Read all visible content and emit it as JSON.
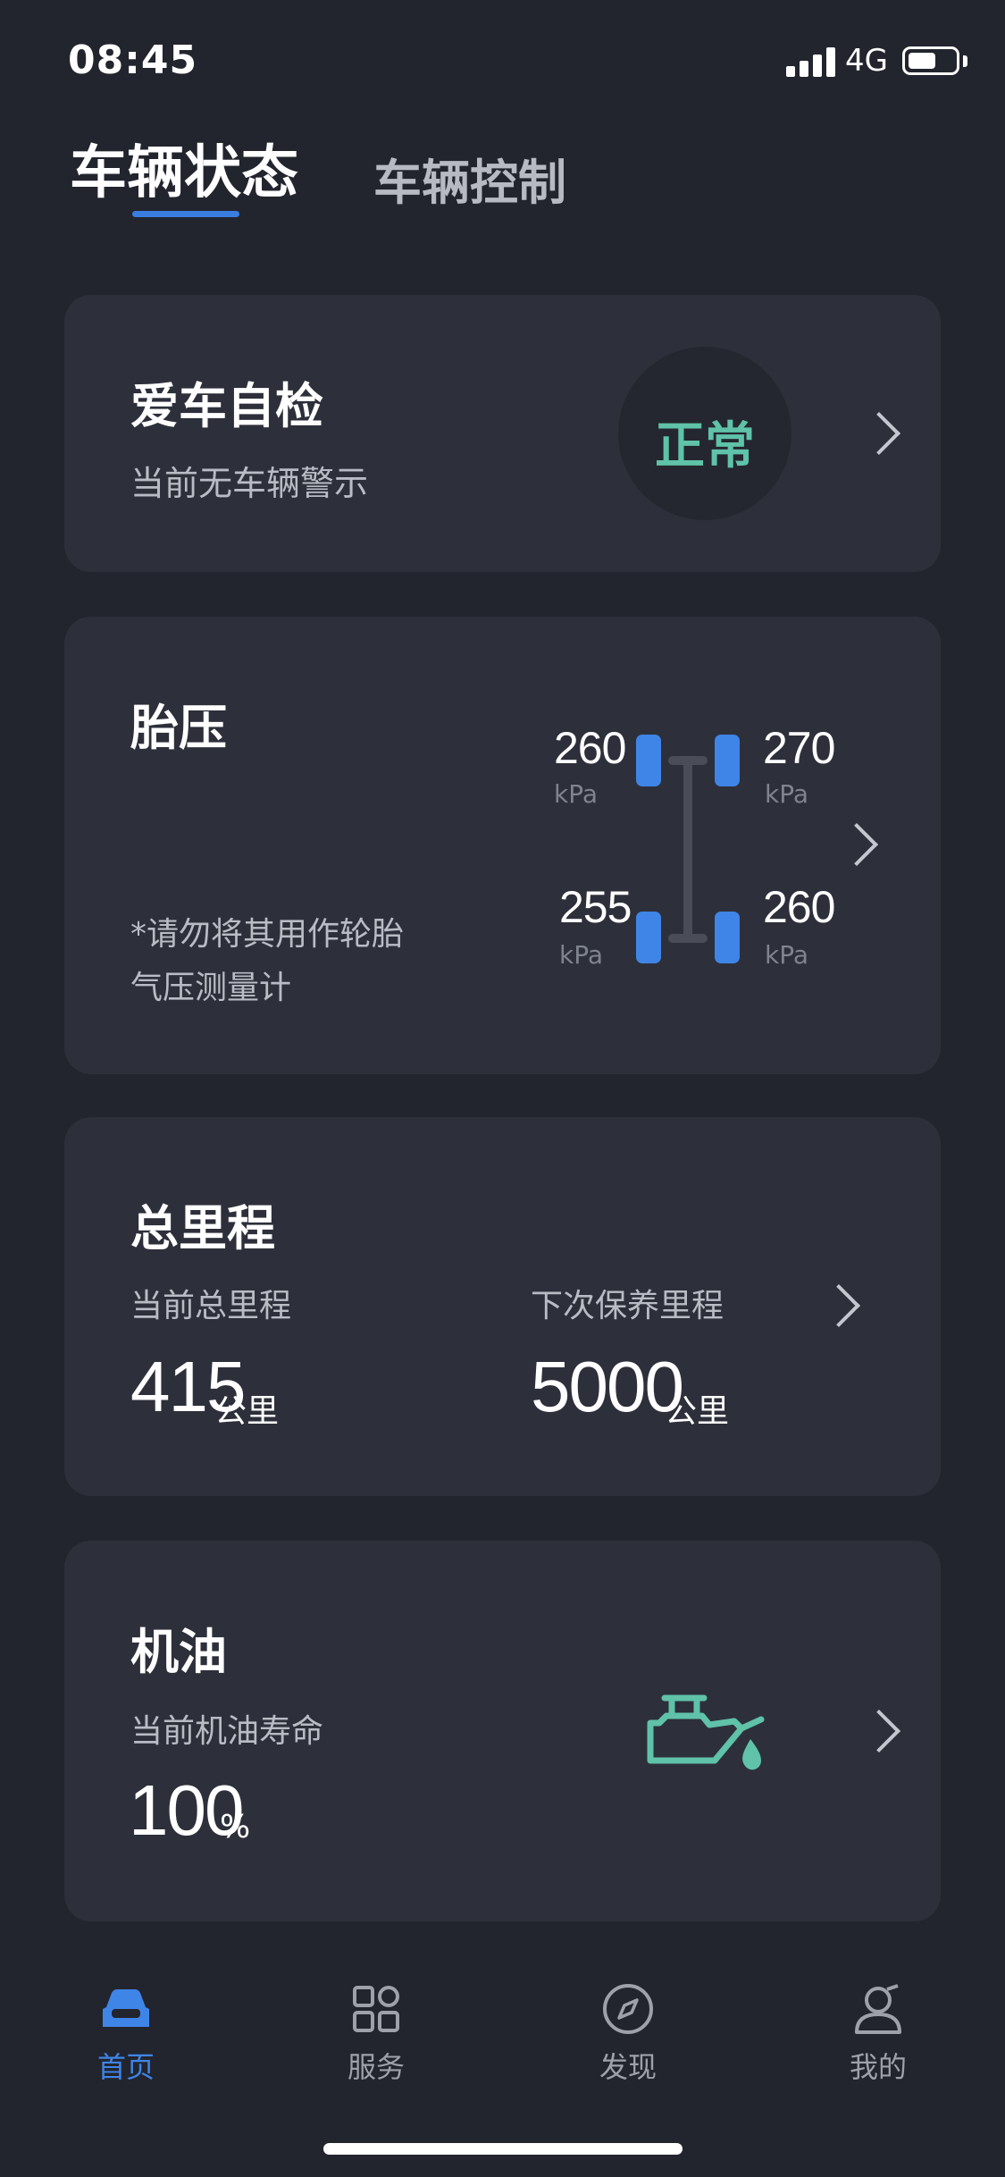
{
  "status_bar": {
    "time": "08:45",
    "network": "4G"
  },
  "tabs": [
    {
      "label": "车辆状态",
      "active": true
    },
    {
      "label": "车辆控制",
      "active": false
    }
  ],
  "self_check": {
    "title": "爱车自检",
    "subtitle": "当前无车辆警示",
    "status": "正常",
    "status_color": "#5fc2a9"
  },
  "tire_pressure": {
    "title": "胎压",
    "note_line1": "*请勿将其用作轮胎",
    "note_line2": "气压测量计",
    "unit": "kPa",
    "front_left": "260",
    "front_right": "270",
    "rear_left": "255",
    "rear_right": "260"
  },
  "mileage": {
    "title": "总里程",
    "current_label": "当前总里程",
    "current_value": "415",
    "next_label": "下次保养里程",
    "next_value": "5000",
    "unit": "公里"
  },
  "oil": {
    "title": "机油",
    "label": "当前机油寿命",
    "value": "100",
    "unit": "%",
    "icon_color": "#5fc2a9"
  },
  "bottom_nav": [
    {
      "label": "首页",
      "icon": "car-icon",
      "active": true
    },
    {
      "label": "服务",
      "icon": "grid-icon",
      "active": false
    },
    {
      "label": "发现",
      "icon": "compass-icon",
      "active": false
    },
    {
      "label": "我的",
      "icon": "user-icon",
      "active": false
    }
  ],
  "accent_color": "#3f85e8"
}
